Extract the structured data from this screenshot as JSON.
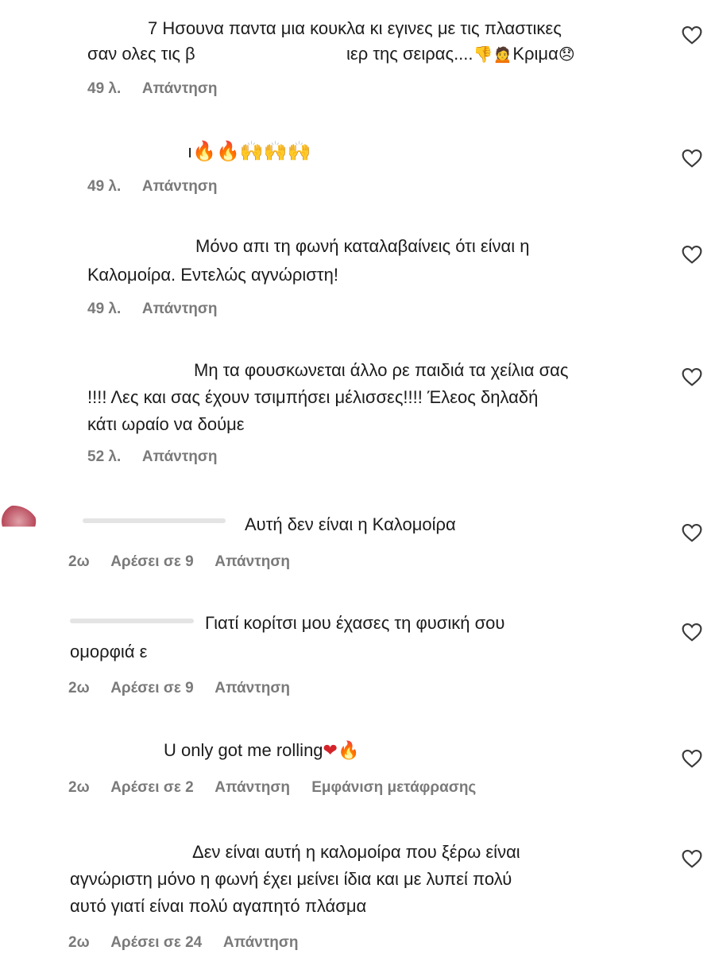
{
  "heart_icon_color": "#3a3a3a",
  "meta_color": "#7a7a7a",
  "comments": [
    {
      "lines": [
        "7 Ησουνα παντα μια κουκλα κι εγινες με τις πλαστικες",
        "σαν ολες τις β",
        "ιερ της σειρας....",
        "Κριμα"
      ],
      "emojis_1": "👎🙍",
      "emojis_2": "😞",
      "time": "49 λ.",
      "reply": "Απάντηση"
    },
    {
      "prefix": "ı",
      "emojis": "🔥🔥🙌🙌🙌",
      "time": "49 λ.",
      "reply": "Απάντηση"
    },
    {
      "lines": [
        "Μόνο απι τη φωνή καταλαβαίνεις ότι είναι η",
        "Καλομοίρα. Εντελώς αγνώριστη!"
      ],
      "time": "49 λ.",
      "reply": "Απάντηση"
    },
    {
      "lines": [
        "Μη τα φουσκωνεται άλλο ρε παιδιά τα χείλια σας",
        "!!!! Λες και σας έχουν τσιμπήσει μέλισσες!!!! Έλεος δηλαδή",
        "κάτι ωραίο να δούμε"
      ],
      "time": "52 λ.",
      "reply": "Απάντηση"
    },
    {
      "lines": [
        "Αυτή δεν είναι η Καλομοίρα"
      ],
      "time": "2ω",
      "likes": "Αρέσει σε 9",
      "reply": "Απάντηση"
    },
    {
      "lines": [
        "Γιατί κορίτσι μου έχασες τη φυσική σου",
        "ομορφιά ε"
      ],
      "time": "2ω",
      "likes": "Αρέσει σε 9",
      "reply": "Απάντηση"
    },
    {
      "lines": [
        "U only got me rolling"
      ],
      "emojis": "❤🔥",
      "time": "2ω",
      "likes": "Αρέσει σε 2",
      "reply": "Απάντηση",
      "translate": "Εμφάνιση μετάφρασης"
    },
    {
      "lines": [
        "Δεν είναι αυτή η καλομοίρα που ξέρω είναι",
        "αγνώριστη μόνο η φωνή έχει μείνει ίδια και με λυπεί πολύ",
        "αυτό γιατί είναι πολύ αγαπητό πλάσμα"
      ],
      "time": "2ω",
      "likes": "Αρέσει σε 24",
      "reply": "Απάντηση"
    }
  ]
}
